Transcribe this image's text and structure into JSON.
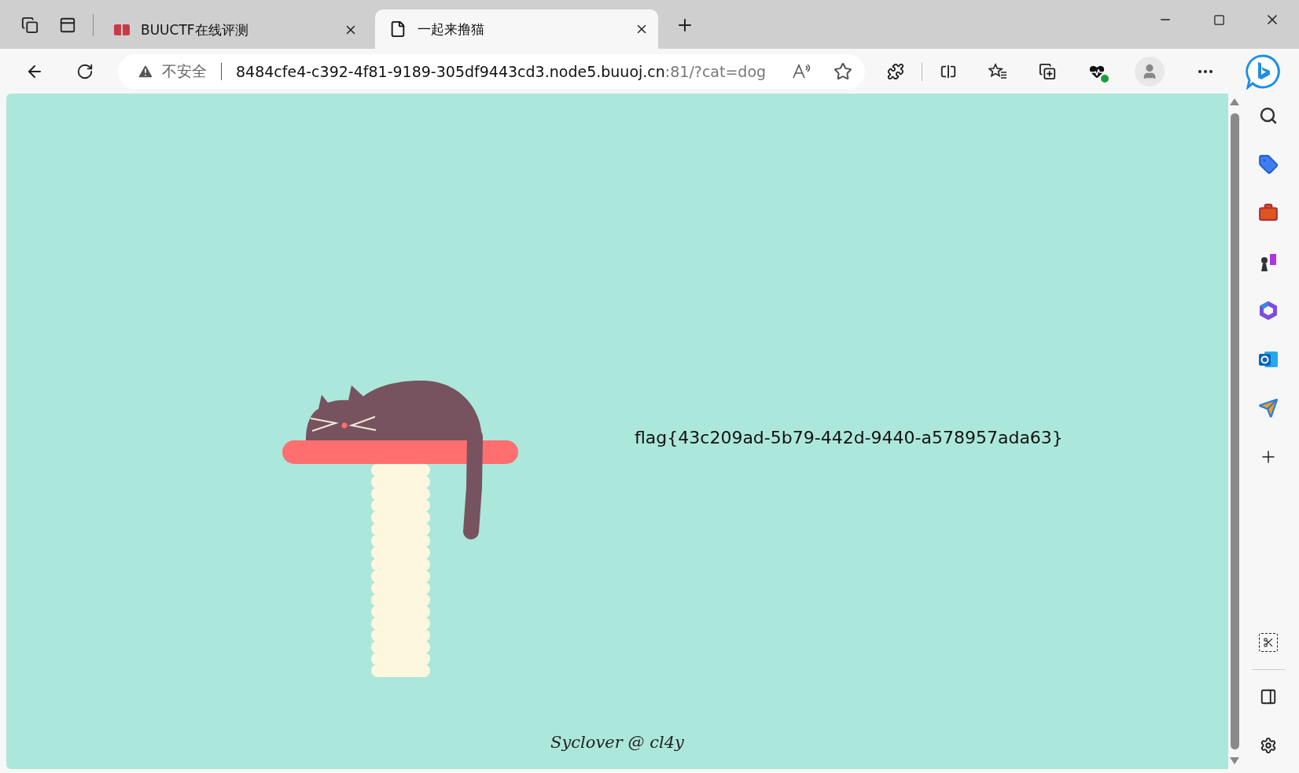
{
  "tabs": [
    {
      "kind": "site",
      "title": "BUUCTF在线评测",
      "selected": false
    },
    {
      "kind": "page",
      "title": "一起来撸猫",
      "selected": true
    }
  ],
  "address_bar": {
    "security_label": "不安全",
    "url_host": "8484cfe4-c392-4f81-9189-305df9443cd3.node5.buuoj.cn",
    "url_rest": ":81/?cat=dog"
  },
  "page": {
    "flag": "flag{43c209ad-5b79-442d-9440-a578957ada63}",
    "footer": "Syclover @ cl4y"
  }
}
